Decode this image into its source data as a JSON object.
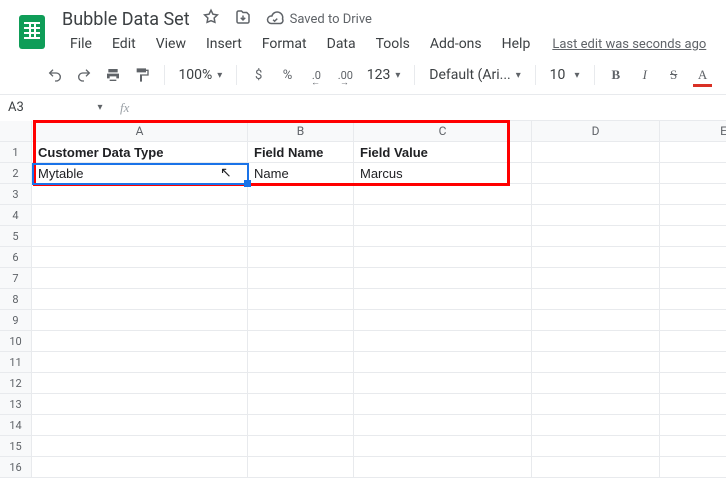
{
  "doc": {
    "title": "Bubble Data Set",
    "saved_status": "Saved to Drive"
  },
  "menus": [
    "File",
    "Edit",
    "View",
    "Insert",
    "Format",
    "Data",
    "Tools",
    "Add-ons",
    "Help"
  ],
  "last_edit": "Last edit was seconds ago",
  "toolbar": {
    "zoom": "100%",
    "currency": "$",
    "percent": "%",
    "dec_less": ".0",
    "dec_more": ".00",
    "num_format": "123",
    "font": "Default (Ari...",
    "size": "10"
  },
  "namebox": {
    "value": "A3"
  },
  "columns": [
    "A",
    "B",
    "C",
    "D",
    "E"
  ],
  "row_count": 16,
  "cells": {
    "A1": "Customer Data Type",
    "B1": "Field Name",
    "C1": "Field Value",
    "A2": "Mytable",
    "B2": "Name",
    "C2": "Marcus"
  },
  "selected_cell": "A3",
  "chart_data": {
    "type": "table",
    "columns": [
      "Customer Data Type",
      "Field Name",
      "Field Value"
    ],
    "rows": [
      [
        "Mytable",
        "Name",
        "Marcus"
      ]
    ]
  }
}
